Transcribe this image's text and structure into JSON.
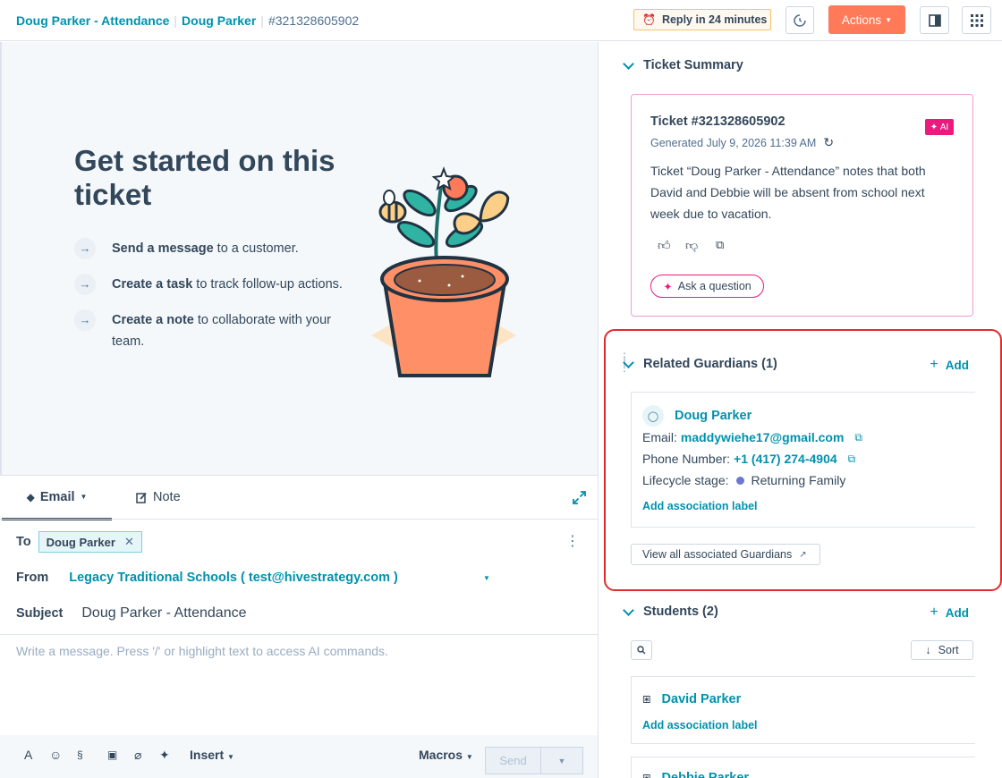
{
  "header": {
    "ticket_name": "Doug Parker - Attendance",
    "contact_name": "Doug Parker",
    "ticket_id": "#321328605902",
    "reply_badge": "Reply in 24 minutes",
    "actions_label": "Actions"
  },
  "started": {
    "title": "Get started on this ticket",
    "steps": [
      {
        "bold": "Send a message",
        "rest": " to a customer."
      },
      {
        "bold": "Create a task",
        "rest": " to track follow-up actions."
      },
      {
        "bold": "Create a note",
        "rest": " to collaborate with your team."
      }
    ]
  },
  "composer": {
    "tab_email": "Email",
    "tab_note": "Note",
    "to_label": "To",
    "to_chip": "Doug Parker",
    "from_label": "From",
    "from_value": "Legacy Traditional Schools ( test@hivestrategy.com )",
    "subject_label": "Subject",
    "subject_value": "Doug Parker - Attendance",
    "placeholder": "Write a message. Press '/' or highlight text to access AI commands.",
    "insert_label": "Insert",
    "macros_label": "Macros",
    "send_label": "Send"
  },
  "summary": {
    "section_title": "Ticket Summary",
    "card_title": "Ticket #321328605902",
    "generated": "Generated July 9, 2026 11:39 AM",
    "ai_badge": "AI",
    "body": "Ticket “Doug Parker - Attendance” notes that both David and Debbie will be absent from school next week due to vacation.",
    "ask_label": "Ask a question"
  },
  "guardians": {
    "section_title": "Related Guardians (1)",
    "add_label": "Add",
    "name": "Doug Parker",
    "email_label": "Email:",
    "email": "maddywiehe17@gmail.com",
    "phone_label": "Phone Number:",
    "phone": "+1 (417) 274-4904",
    "lifecycle_label": "Lifecycle stage:",
    "lifecycle": "Returning Family",
    "assoc_label": "Add association label",
    "view_all": "View all associated Guardians"
  },
  "students": {
    "section_title": "Students (2)",
    "add_label": "Add",
    "sort_label": "Sort",
    "items": [
      {
        "name": "David Parker",
        "assoc": "Add association label"
      },
      {
        "name": "Debbie Parker"
      }
    ]
  },
  "colors": {
    "teal": "#0091ae",
    "orange": "#ff7a59",
    "ai_pink": "#ea1a7f",
    "highlight_red": "#e02b2b"
  }
}
